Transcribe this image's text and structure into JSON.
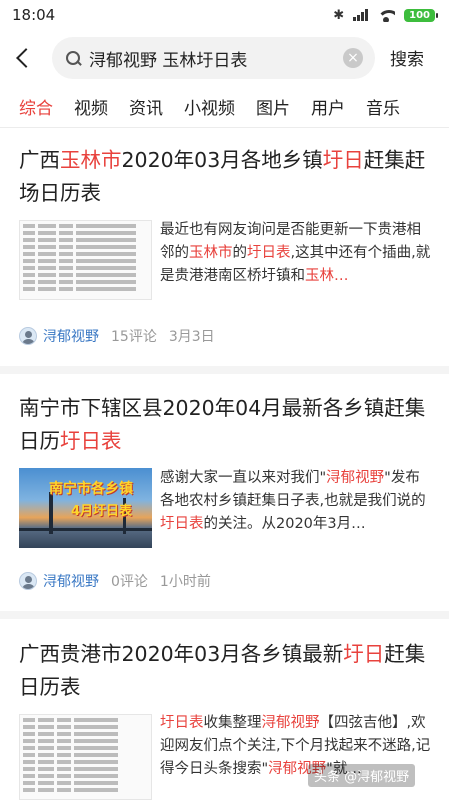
{
  "status_bar": {
    "time": "18:04",
    "battery": "100"
  },
  "search": {
    "query": "浔郁视野 玉林圩日表",
    "button": "搜索"
  },
  "tabs": [
    "综合",
    "视频",
    "资讯",
    "小视频",
    "图片",
    "用户",
    "音乐"
  ],
  "articles": [
    {
      "title_parts": [
        "广西",
        "玉林市",
        "2020年03月各地乡镇",
        "圩日",
        "赶集赶场日历表"
      ],
      "snippet_parts": [
        "最近也有网友询问是否能更新一下贵港相邻的",
        "玉林市",
        "的",
        "圩日表",
        ",这其中还有个插曲,就是贵港港南区桥圩镇和",
        "玉林…"
      ],
      "author": "浔郁视野",
      "comments": "15评论",
      "time": "3月3日"
    },
    {
      "title_parts": [
        "南宁市下辖区县2020年04月最新各乡镇赶集日历",
        "圩日表"
      ],
      "snippet_parts": [
        "感谢大家一直以来对我们\"",
        "浔郁视野",
        "\"发布各地农村乡镇赶集日子表,也就是我们说的",
        "圩日表",
        "的关注。从2020年3月…"
      ],
      "thumb_text": [
        "南宁市各乡镇",
        "4月圩日表"
      ],
      "author": "浔郁视野",
      "comments": "0评论",
      "time": "1小时前"
    },
    {
      "title_parts": [
        "广西贵港市2020年03月各乡镇最新",
        "圩日",
        "赶集日历表"
      ],
      "snippet_parts": [
        "圩日表",
        "收集整理",
        "浔郁视野",
        "【四弦吉他】,欢迎网友们点个关注,下个月找起来不迷路,记得今日头条搜索\"",
        "浔郁视野",
        "\"就…"
      ]
    }
  ],
  "watermark": "头条 @浔郁视野",
  "colors": {
    "accent": "#e8423d",
    "author": "#3a78c4",
    "battery": "#3dbd3d"
  }
}
